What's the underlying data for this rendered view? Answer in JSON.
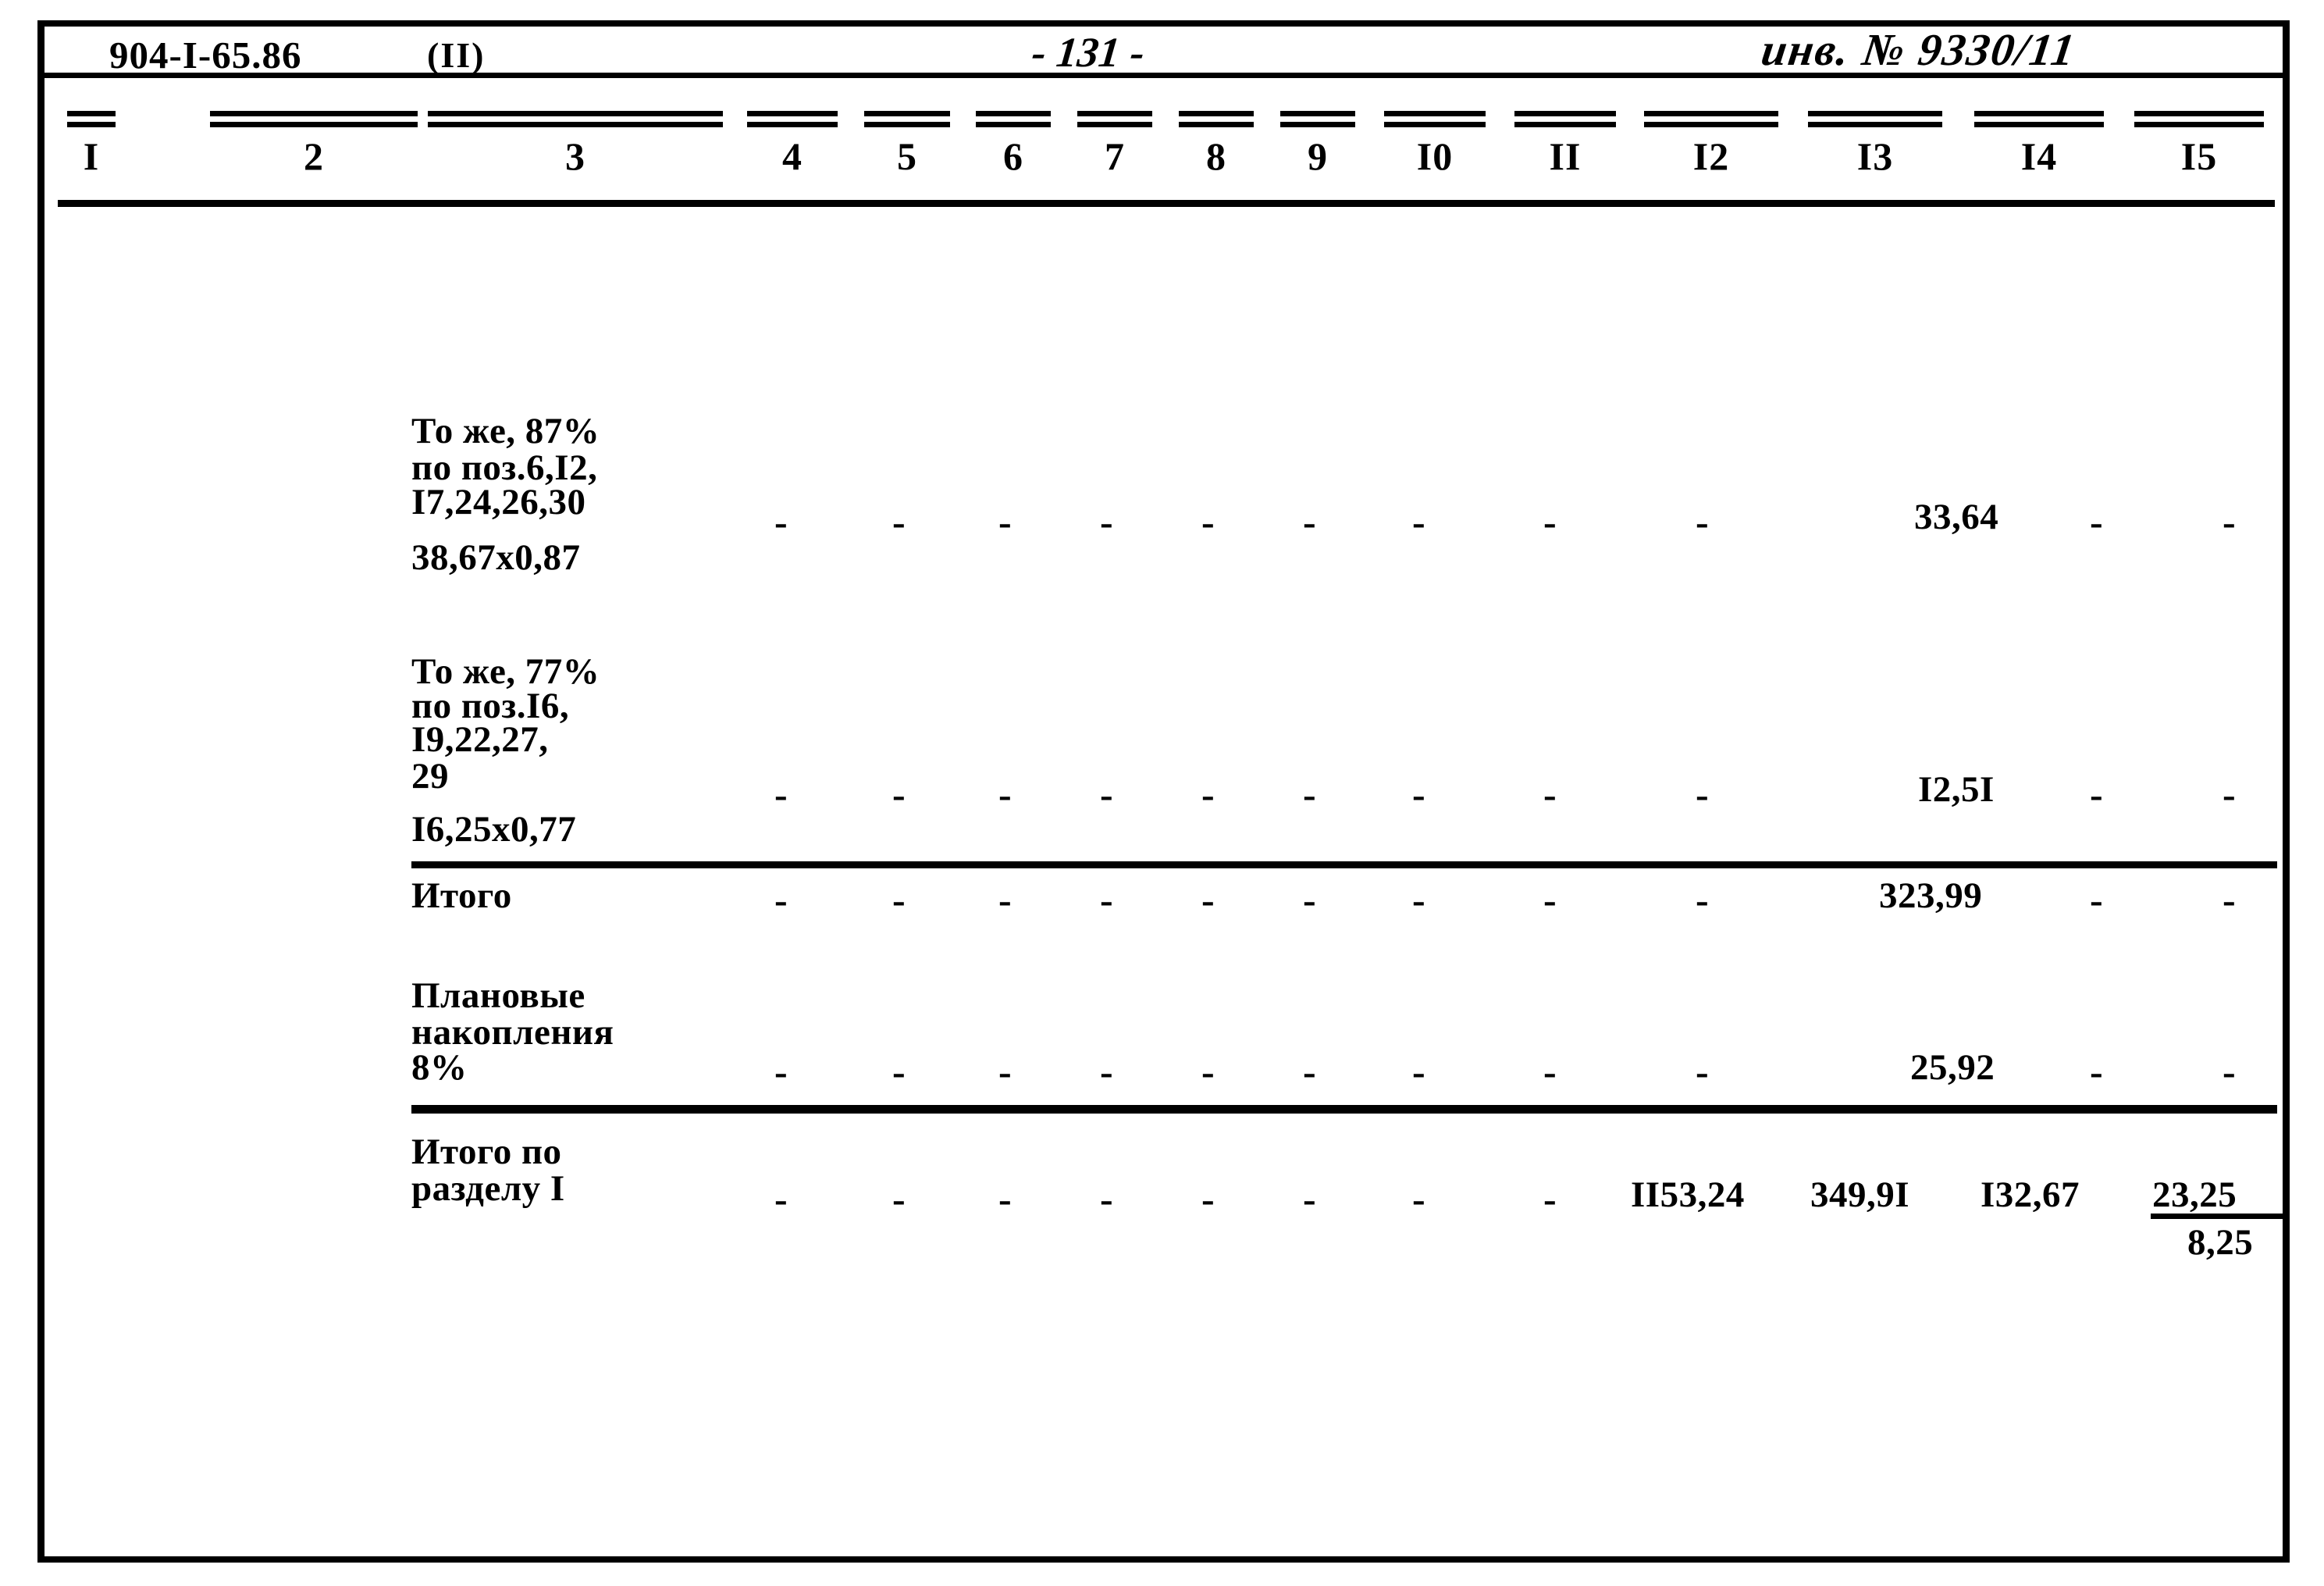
{
  "document": {
    "code": "904-I-65.86",
    "variant": "(II)",
    "page_number": "- 131 -",
    "inventory": "инв. № 9330/11"
  },
  "table": {
    "column_headers": [
      "I",
      "2",
      "3",
      "4",
      "5",
      "6",
      "7",
      "8",
      "9",
      "I0",
      "II",
      "I2",
      "I3",
      "I4",
      "I5"
    ],
    "dash": "-",
    "rows": [
      {
        "name": "row-same-87",
        "description_lines": [
          "То же, 87%",
          "по поз.6,I2,",
          "I7,24,26,30"
        ],
        "formula": "38,67x0,87",
        "c4": "-",
        "c5": "-",
        "c6": "-",
        "c7": "-",
        "c8": "-",
        "c9": "-",
        "c10": "-",
        "c11": "-",
        "c12": "-",
        "c13": "33,64",
        "c14": "-",
        "c15": "-"
      },
      {
        "name": "row-same-77",
        "description_lines": [
          "То же, 77%",
          "по поз.I6,",
          "I9,22,27,",
          "29"
        ],
        "formula": "I6,25x0,77",
        "c4": "-",
        "c5": "-",
        "c6": "-",
        "c7": "-",
        "c8": "-",
        "c9": "-",
        "c10": "-",
        "c11": "-",
        "c12": "-",
        "c13": "I2,5I",
        "c14": "-",
        "c15": "-"
      },
      {
        "name": "row-total",
        "description_lines": [
          "Итого"
        ],
        "formula": "",
        "c4": "-",
        "c5": "-",
        "c6": "-",
        "c7": "-",
        "c8": "-",
        "c9": "-",
        "c10": "-",
        "c11": "-",
        "c12": "-",
        "c13": "323,99",
        "c14": "-",
        "c15": "-"
      },
      {
        "name": "row-planned-savings",
        "description_lines": [
          "Плановые",
          "накопления",
          "8%"
        ],
        "formula": "",
        "c4": "-",
        "c5": "-",
        "c6": "-",
        "c7": "-",
        "c8": "-",
        "c9": "-",
        "c10": "-",
        "c11": "-",
        "c12": "-",
        "c13": "25,92",
        "c14": "-",
        "c15": "-"
      },
      {
        "name": "row-section-total",
        "description_lines": [
          "Итого по",
          "разделу I"
        ],
        "formula": "",
        "c4": "-",
        "c5": "-",
        "c6": "-",
        "c7": "-",
        "c8": "-",
        "c9": "-",
        "c10": "-",
        "c11": "-",
        "c12": "II53,24",
        "c13": "349,9I",
        "c14": "I32,67",
        "c15_numerator": "23,25",
        "c15_denominator": "8,25"
      }
    ]
  }
}
